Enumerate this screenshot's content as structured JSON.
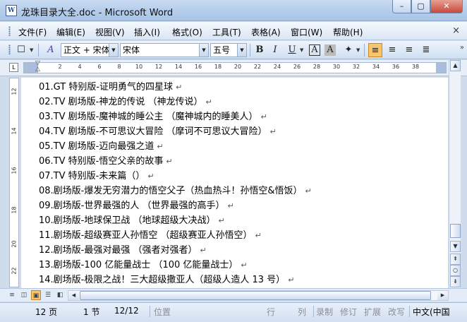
{
  "window": {
    "title": "龙珠目录大全.doc - Microsoft Word",
    "app_icon_letter": "W",
    "minimize_glyph": "–",
    "maximize_glyph": "▢",
    "close_glyph": "✕"
  },
  "menu": {
    "items": [
      "文件(F)",
      "编辑(E)",
      "视图(V)",
      "插入(I)",
      "格式(O)",
      "工具(T)",
      "表格(A)",
      "窗口(W)",
      "帮助(H)"
    ],
    "close_glyph": "×"
  },
  "toolbar": {
    "new_glyph": "☐",
    "style_icon": "A",
    "style_value": "正文 + 宋体",
    "font_value": "宋体",
    "size_value": "五号",
    "bold": "B",
    "italic": "I",
    "underline": "U",
    "char_border": "A",
    "char_shading": "A",
    "highlight_glyph": "✦",
    "dropdown_glyph": "▼",
    "align_left_glyph": "≡",
    "align_center_glyph": "≡",
    "align_right_glyph": "≡",
    "justify_glyph": "≣",
    "more_glyph": "»"
  },
  "ruler": {
    "corner_glyph": "L",
    "ticks": [
      "2",
      "4",
      "6",
      "8",
      "10",
      "12",
      "14",
      "16",
      "18",
      "20",
      "22",
      "24",
      "26",
      "28",
      "30",
      "32",
      "34",
      "36",
      "38"
    ],
    "vticks": [
      "12",
      "14",
      "16",
      "18",
      "20",
      "22"
    ]
  },
  "document": {
    "para_mark": "↵",
    "lines": [
      "01.GT 特别版-证明勇气的四星球",
      "02.TV 剧场版-神龙的传说 （神龙传说）",
      "03.TV 剧场版-魔神城的睡公主 （魔神城内的睡美人）",
      "04.TV 剧场版-不可思议大冒险 （摩诃不可思议大冒险）",
      "05.TV 剧场版-迈向最强之道",
      "06.TV 特别版-悟空父亲的故事",
      "07.TV 特别版-未来篇（）",
      "08.剧场版-爆发无穷潜力的悟空父子（热血热斗！孙悟空&悟饭）",
      "09.剧场版-世界最强的人 （世界最强的高手）",
      "10.剧场版-地球保卫战 （地球超级大决战）",
      "11.剧场版-超级赛亚人孙悟空 （超级赛亚人孙悟空）",
      "12.剧场版-最强对最强 （强者对强者）",
      "13.剧场版-100 亿能量战士 （100 亿能量战士）",
      "14.剧场版-极限之战！三大超级撒亚人（超级人造人 13 号）"
    ]
  },
  "scrollbar": {
    "up_glyph": "▲",
    "down_glyph": "▼",
    "prev_page_glyph": "⇞",
    "browse_glyph": "○",
    "next_page_glyph": "⇟",
    "left_glyph": "◀",
    "right_glyph": "▶"
  },
  "views": {
    "normal": "≡",
    "web": "◫",
    "print": "▣",
    "outline": "☰",
    "reading": "◧"
  },
  "status": {
    "page": "12 页",
    "section": "1 节",
    "page_of": "12/12",
    "position": "位置",
    "line": "行",
    "column": "列",
    "record": "录制",
    "revisions": "修订",
    "extend": "扩展",
    "overtype": "改写",
    "language": "中文(中国"
  }
}
